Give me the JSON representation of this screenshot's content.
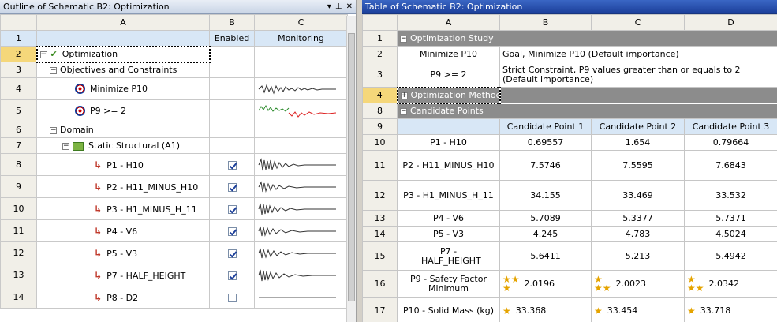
{
  "left_panel": {
    "title": "Outline of Schematic B2: Optimization",
    "buttons": [
      "▾",
      "⊥",
      "✕"
    ],
    "columns": [
      "A",
      "B",
      "C"
    ],
    "subheaders": [
      "",
      "Enabled",
      "Monitoring"
    ],
    "rows": [
      {
        "n": "1",
        "label": ""
      },
      {
        "n": "2",
        "label": "Optimization"
      },
      {
        "n": "3",
        "label": "Objectives and Constraints"
      },
      {
        "n": "4",
        "label": "Minimize P10"
      },
      {
        "n": "5",
        "label": "P9 >= 2"
      },
      {
        "n": "6",
        "label": "Domain"
      },
      {
        "n": "7",
        "label": "Static Structural (A1)"
      },
      {
        "n": "8",
        "label": "P1 - H10",
        "enabled": true
      },
      {
        "n": "9",
        "label": "P2 - H11_MINUS_H10",
        "enabled": true
      },
      {
        "n": "10",
        "label": "P3 - H1_MINUS_H_11",
        "enabled": true
      },
      {
        "n": "11",
        "label": "P4 - V6",
        "enabled": true
      },
      {
        "n": "12",
        "label": "P5 - V3",
        "enabled": true
      },
      {
        "n": "13",
        "label": "P7 - HALF_HEIGHT",
        "enabled": true
      },
      {
        "n": "14",
        "label": "P8 - D2",
        "enabled": false
      }
    ]
  },
  "right_panel": {
    "title": "Table of Schematic B2: Optimization",
    "columns": [
      "A",
      "B",
      "C",
      "D"
    ],
    "rows": {
      "r1": {
        "n": "1",
        "a": "Optimization Study"
      },
      "r2": {
        "n": "2",
        "a": "Minimize P10",
        "b": "Goal, Minimize P10 (Default importance)"
      },
      "r3": {
        "n": "3",
        "a": "P9 >= 2",
        "b": "Strict Constraint, P9 values greater than or equals to 2 (Default importance)"
      },
      "r4": {
        "n": "4",
        "a": "Optimization Method"
      },
      "r8": {
        "n": "8",
        "a": "Candidate Points"
      },
      "r9": {
        "n": "9",
        "b": "Candidate Point 1",
        "c": "Candidate Point 2",
        "d": "Candidate Point 3"
      },
      "r10": {
        "n": "10",
        "a": "P1 - H10",
        "b": "0.69557",
        "c": "1.654",
        "d": "0.79664"
      },
      "r11": {
        "n": "11",
        "a": "P2 - H11_MINUS_H10",
        "b": "7.5746",
        "c": "7.5595",
        "d": "7.6843"
      },
      "r12": {
        "n": "12",
        "a": "P3 - H1_MINUS_H_11",
        "b": "34.155",
        "c": "33.469",
        "d": "33.532"
      },
      "r13": {
        "n": "13",
        "a": "P4 - V6",
        "b": "5.7089",
        "c": "5.3377",
        "d": "5.7371"
      },
      "r14": {
        "n": "14",
        "a": "P5 - V3",
        "b": "4.245",
        "c": "4.783",
        "d": "4.5024"
      },
      "r15": {
        "n": "15",
        "a": "P7 - HALF_HEIGHT",
        "b": "5.6411",
        "c": "5.213",
        "d": "5.4942"
      },
      "r16": {
        "n": "16",
        "a": "P9 - Safety Factor Minimum",
        "b": "2.0196",
        "c": "2.0023",
        "d": "2.0342"
      },
      "r17": {
        "n": "17",
        "a": "P10 - Solid Mass (kg)",
        "b": "33.368",
        "c": "33.454",
        "d": "33.718"
      }
    },
    "expander_collapsed": "⊞",
    "expander_expanded": "⊟"
  },
  "colors": {
    "selection": "#f5d77a",
    "group_row": "#8c8c8c",
    "title_active": "#1c3f9a"
  }
}
